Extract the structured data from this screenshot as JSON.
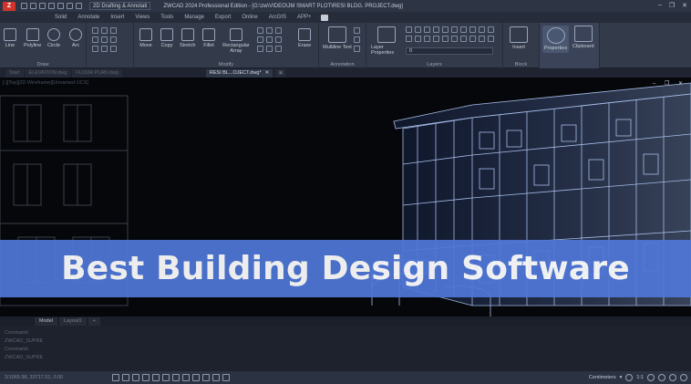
{
  "titlebar": {
    "app_logo": "Z",
    "workspace": "2D Drafting & Annotati",
    "title": "ZWCAD 2024 Professional Edition - [G:\\zw\\VIDEO\\JM SMART PLOT\\RESI BLDG. PROJECT.dwg]",
    "controls": [
      "–",
      "❐",
      "✕"
    ]
  },
  "menu": {
    "tabs": [
      "Solid",
      "Annotate",
      "Insert",
      "Views",
      "Tools",
      "Manage",
      "Export",
      "Online",
      "ArcGIS",
      "APP+"
    ]
  },
  "ribbon": {
    "draw": {
      "buttons": [
        "Line",
        "Polyline",
        "Circle",
        "Arc"
      ],
      "label": "Draw"
    },
    "modify": {
      "buttons": [
        "Move",
        "Copy",
        "Stretch",
        "Fillet",
        "Rectangular Array",
        "Erase"
      ],
      "label": "Modify"
    },
    "annotation": {
      "buttons": [
        "Multiline Text"
      ],
      "label": "Annotation"
    },
    "layers": {
      "buttons": [
        "Layer Properties"
      ],
      "combo_value": "0",
      "label": "Layers"
    },
    "block": {
      "buttons": [
        "Insert"
      ],
      "label": "Block"
    },
    "properties": {
      "label": "Properties"
    },
    "clipboard": {
      "label": "Clipboard"
    }
  },
  "doctabs": {
    "tabs": [
      "Start",
      "ELEVATION.dwg",
      "FLOOR PLAN.dwg",
      "RESI BL...OJECT.dwg*"
    ],
    "close": "✕"
  },
  "viewport": {
    "label": "[-][Top][2D Wireframe][Unnamed UCS]",
    "controls": "– ❐ ✕"
  },
  "banner": {
    "text": "Best Building Design Software",
    "color": "#4f77d8"
  },
  "layout_tabs": [
    "Model",
    "Layout1",
    "+"
  ],
  "command": {
    "lines": [
      "Command:",
      "ZWCAD_SUPRE",
      "Command:",
      "ZWCAD_SUPRE",
      ""
    ]
  },
  "statusbar": {
    "coords": "2/1065.98, 33717.51, 0.00",
    "units": "Centimeters",
    "scale": "1:1"
  }
}
